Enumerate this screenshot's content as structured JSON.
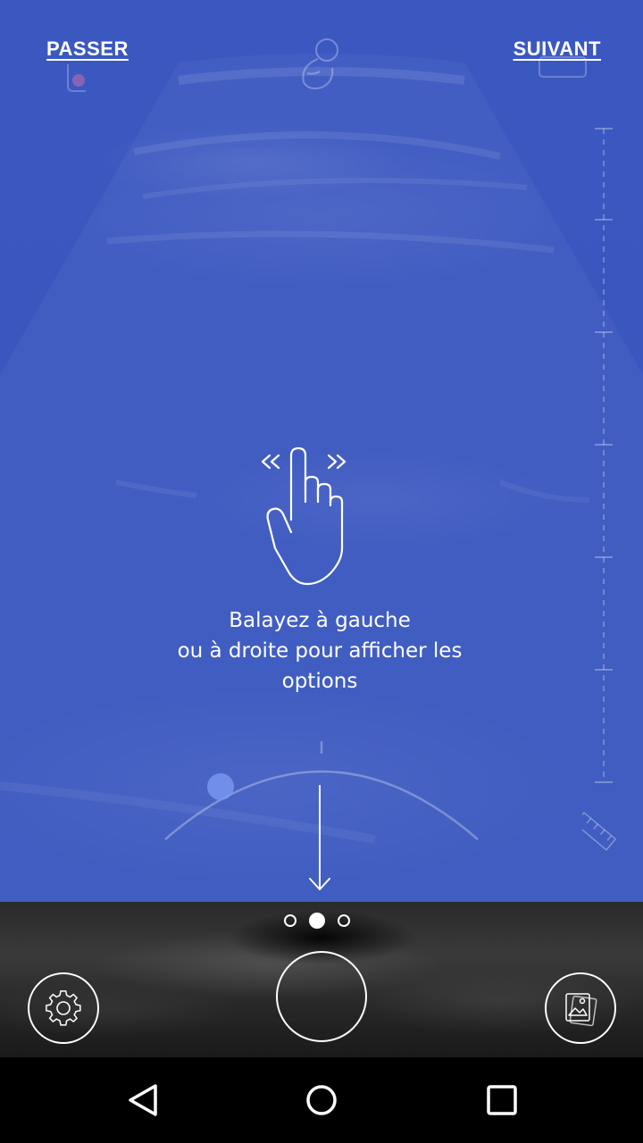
{
  "header": {
    "skip_label": "PASSER",
    "next_label": "SUIVANT"
  },
  "hint": {
    "line1": "Balayez à gauche",
    "line2": "ou à droite pour afficher les",
    "line3": "options"
  },
  "pagination": {
    "total": 3,
    "active_index": 1
  },
  "controls": {
    "settings_icon": "gear-icon",
    "capture_icon": "shutter-circle",
    "gallery_icon": "image-gallery-icon"
  },
  "navbar": {
    "back_icon": "back-triangle-icon",
    "home_icon": "home-circle-icon",
    "recents_icon": "recents-square-icon"
  },
  "colors": {
    "overlay_blue": "#3b58c1",
    "foreground": "#ffffff",
    "navbar": "#000000"
  }
}
